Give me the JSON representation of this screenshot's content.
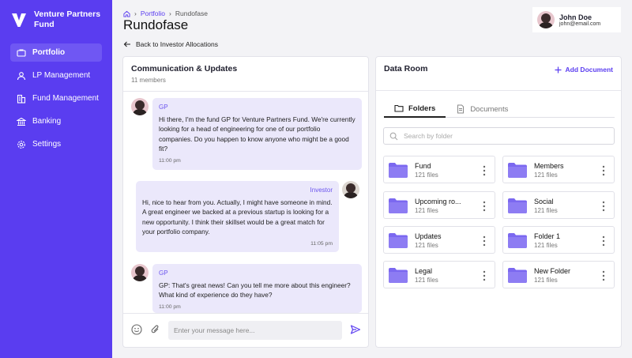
{
  "brand": {
    "name": "Venture Partners Fund"
  },
  "sidebar": {
    "items": [
      {
        "label": "Portfolio",
        "icon": "briefcase-icon",
        "active": true
      },
      {
        "label": "LP Management",
        "icon": "user-icon",
        "active": false
      },
      {
        "label": "Fund Management",
        "icon": "building-icon",
        "active": false
      },
      {
        "label": "Banking",
        "icon": "bank-icon",
        "active": false
      },
      {
        "label": "Settings",
        "icon": "gear-icon",
        "active": false
      }
    ]
  },
  "breadcrumb": {
    "home_icon": "home-icon",
    "parent": "Portfolio",
    "current": "Rundofase"
  },
  "page": {
    "title": "Rundofase",
    "back_label": "Back to Investor Allocations"
  },
  "user": {
    "name": "John Doe",
    "email": "john@email.com"
  },
  "chat": {
    "title": "Communication & Updates",
    "members": "11 members",
    "messages": [
      {
        "sender": "GP",
        "text": "Hi there, I'm the fund GP for Venture Partners Fund. We're currently looking for a head of engineering for one of our portfolio companies. Do you happen to know anyone who might be a good fit?",
        "time": "11:00 pm"
      },
      {
        "sender": "Investor",
        "text": "Hi, nice to hear from you. Actually, I might have someone in mind. A great engineer we backed at a previous startup is looking for a new opportunity. I think their skillset would be a great match for your portfolio company.",
        "time": "11:05 pm"
      },
      {
        "sender": "GP",
        "text": "GP: That's great news! Can you tell me more about this engineer? What kind of experience do they have?",
        "time": "11:00 pm"
      }
    ],
    "input_placeholder": "Enter your message here..."
  },
  "data_room": {
    "title": "Data Room",
    "add_label": "Add Document",
    "tabs": [
      {
        "label": "Folders",
        "active": true
      },
      {
        "label": "Documents",
        "active": false
      }
    ],
    "search_placeholder": "Search by folder",
    "folders": [
      {
        "name": "Fund",
        "count": "121 files"
      },
      {
        "name": "Members",
        "count": "121 files"
      },
      {
        "name": "Upcoming ro...",
        "count": "121 files"
      },
      {
        "name": "Social",
        "count": "121 files"
      },
      {
        "name": "Updates",
        "count": "121 files"
      },
      {
        "name": "Folder 1",
        "count": "121 files"
      },
      {
        "name": "Legal",
        "count": "121 files"
      },
      {
        "name": "New Folder",
        "count": "121 files"
      }
    ]
  },
  "colors": {
    "accent": "#5a3df0",
    "bubble": "#ebe8fb",
    "folder": "#7b68f0"
  }
}
